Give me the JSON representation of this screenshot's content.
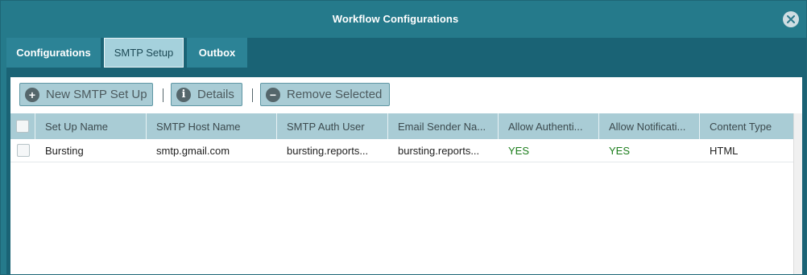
{
  "window": {
    "title": "Workflow Configurations"
  },
  "tabs": [
    {
      "label": "Configurations"
    },
    {
      "label": "SMTP Setup"
    },
    {
      "label": "Outbox"
    }
  ],
  "toolbar": {
    "new_label": "New SMTP Set Up",
    "details_label": "Details",
    "remove_label": "Remove Selected"
  },
  "table": {
    "columns": [
      "Set Up Name",
      "SMTP Host Name",
      "SMTP Auth User",
      "Email Sender Na...",
      "Allow Authenti...",
      "Allow Notificati...",
      "Content Type"
    ],
    "rows": [
      {
        "setup_name": "Bursting",
        "host": "smtp.gmail.com",
        "auth_user": "bursting.reports...",
        "sender": "bursting.reports...",
        "allow_auth": "YES",
        "allow_notif": "YES",
        "content_type": "HTML"
      }
    ]
  },
  "colors": {
    "frame": "#257a8b",
    "active_tab": "#a5d1dc",
    "header": "#a9ccd5",
    "yes_text": "#1b7d1b"
  }
}
